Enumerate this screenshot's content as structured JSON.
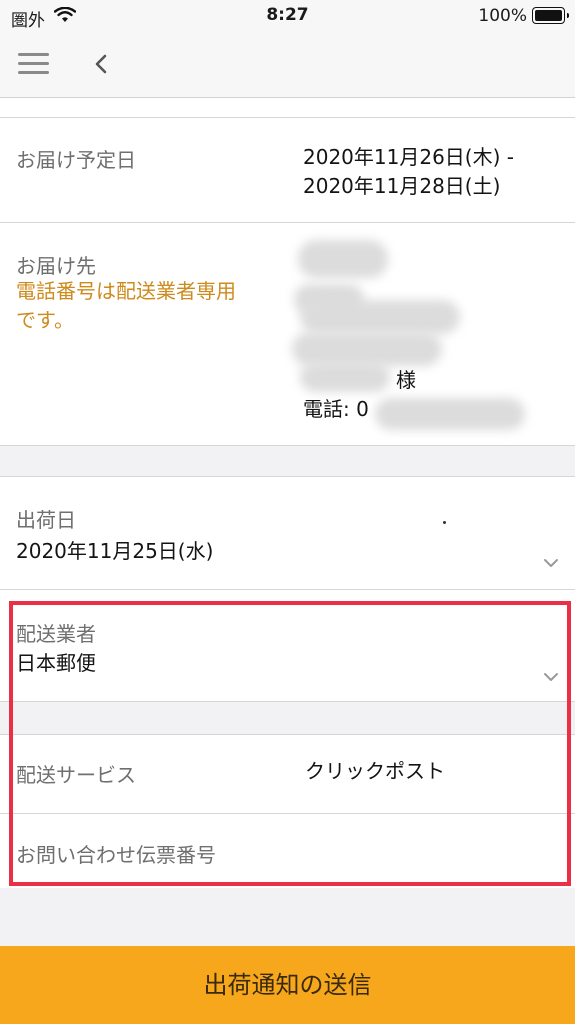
{
  "status_bar": {
    "carrier": "圏外",
    "time": "8:27",
    "battery": "100%"
  },
  "icons": {
    "menu": "hamburger-menu-icon",
    "back": "chevron-left-icon",
    "dropdown": "chevron-down-icon"
  },
  "delivery": {
    "date_label": "お届け予定日",
    "date_line1": "2020年11月26日(木) -",
    "date_line2": "2020年11月28日(土)",
    "address_label": "お届け先",
    "address_note_line1": "電話番号は配送業者専用",
    "address_note_line2": "です。",
    "honorific": "様",
    "phone_prefix": "電話: 0"
  },
  "shipping": {
    "ship_date_label": "出荷日",
    "ship_date_value": "2020年11月25日(水)",
    "carrier_label": "配送業者",
    "carrier_value": "日本郵便",
    "service_label": "配送サービス",
    "service_value": "クリックポスト",
    "tracking_label": "お問い合わせ伝票番号",
    "tracking_value": ""
  },
  "submit_label": "出荷通知の送信",
  "colors": {
    "accent": "#f7a71c",
    "note": "#cf8a1c",
    "highlight": "#e93046"
  }
}
